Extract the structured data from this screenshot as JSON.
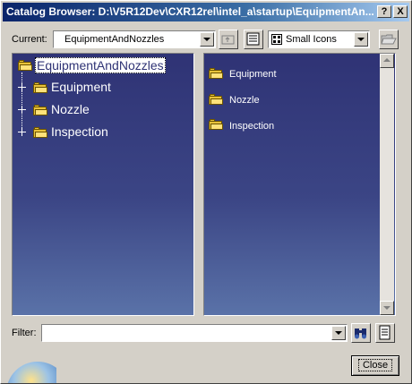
{
  "window": {
    "title": "Catalog Browser: D:\\V5R12Dev\\CXR12rel\\intel_a\\startup\\EquipmentAn...",
    "help_label": "?",
    "close_label": "X"
  },
  "toolbar": {
    "current_label": "Current:",
    "current_value": "EquipmentAndNozzles",
    "view_mode_value": "Small Icons"
  },
  "tree": {
    "root": "EquipmentAndNozzles",
    "children": [
      "Equipment",
      "Nozzle",
      "Inspection"
    ]
  },
  "list": {
    "items": [
      "Equipment",
      "Nozzle",
      "Inspection"
    ]
  },
  "filter": {
    "label": "Filter:",
    "value": ""
  },
  "footer": {
    "close_button": "Close"
  },
  "icons": {
    "folder": "folder-icon",
    "up_folder": "up-folder-icon",
    "search": "binoculars-icon",
    "filter_options": "filter-options-icon",
    "browse": "open-folder-icon"
  },
  "colors": {
    "panel_top": "#2f3375",
    "panel_bottom": "#5a72a8",
    "selection": "#ffffff",
    "title_start": "#0a246a"
  }
}
